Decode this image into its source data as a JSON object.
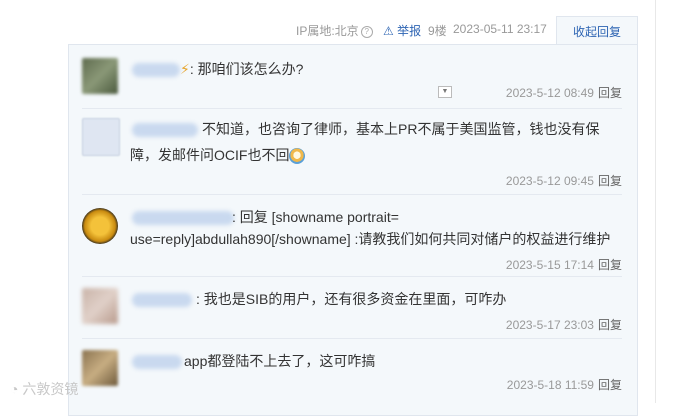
{
  "header": {
    "ip_location": "IP属地:北京",
    "report_label": "举报",
    "floor": "9楼",
    "timestamp": "2023-05-11 23:17",
    "collapse_reply_label": "收起回复"
  },
  "replies": [
    {
      "text": ": 那咱们该怎么办?",
      "time": "2023-5-12 08:49",
      "reply_label": "回复"
    },
    {
      "text_line1": "不知道，也咨询了律师，基本上PR不属于美国监管，钱也没有保",
      "text_line2": "障，发邮件问OCIF也不回",
      "time": "2023-5-12 09:45",
      "reply_label": "回复"
    },
    {
      "text_line1": ": 回复 [showname portrait=",
      "text_line2": "use=reply]abdullah890[/showname] :请教我们如何共同对储户的权益进行维护",
      "time": "2023-5-15 17:14",
      "reply_label": "回复"
    },
    {
      "text": ": 我也是SIB的用户，还有很多资金在里面，可咋办",
      "time": "2023-5-17 23:03",
      "reply_label": "回复"
    },
    {
      "text": "app都登陆不上去了，这可咋搞",
      "time": "2023-5-18 11:59",
      "reply_label": "回复"
    }
  ],
  "watermark": "六敦资镜",
  "colors": {
    "link": "#2d64b3",
    "panel_bg": "#f4f8fb",
    "muted": "#999999"
  }
}
